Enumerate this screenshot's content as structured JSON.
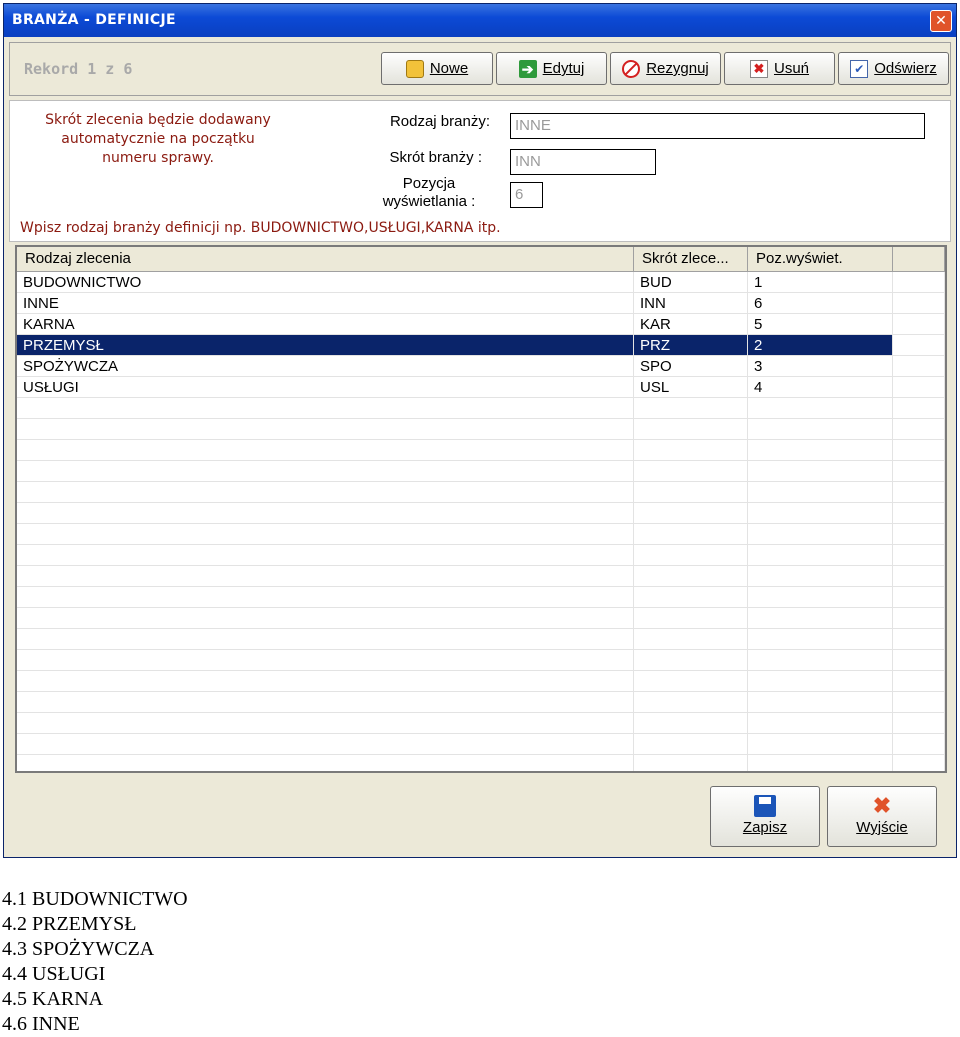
{
  "window": {
    "title": "BRANŻA - DEFINICJE"
  },
  "toolbar": {
    "record": "Rekord 1 z 6",
    "buttons": [
      {
        "label": "Nowe",
        "icon": "new-folder-icon"
      },
      {
        "label": "Edytuj",
        "icon": "edit-arrow-icon"
      },
      {
        "label": "Rezygnuj",
        "icon": "cancel-icon"
      },
      {
        "label": "Usuń",
        "icon": "delete-icon"
      },
      {
        "label": "Odświerz",
        "icon": "refresh-icon"
      }
    ]
  },
  "form": {
    "info_lines": [
      "Skrót zlecenia będzie dodawany",
      "automatycznie na początku",
      "numeru sprawy."
    ],
    "rodzaj_label": "Rodzaj branży:",
    "rodzaj_value": "INNE",
    "skrot_label": "Skrót branży :",
    "skrot_value": "INN",
    "pozycja_label_1": "Pozycja",
    "pozycja_label_2": "wyświetlania :",
    "pozycja_value": "6",
    "hint": "Wpisz rodzaj branży definicji np. BUDOWNICTWO,USŁUGI,KARNA itp."
  },
  "grid": {
    "columns": [
      "Rodzaj zlecenia",
      "Skrót zlece...",
      "Poz.wyświet."
    ],
    "rows": [
      [
        "BUDOWNICTWO",
        "BUD",
        "1"
      ],
      [
        "INNE",
        "INN",
        "6"
      ],
      [
        "KARNA",
        "KAR",
        "5"
      ],
      [
        "PRZEMYSŁ",
        "PRZ",
        "2"
      ],
      [
        "SPOŻYWCZA",
        "SPO",
        "3"
      ],
      [
        "USŁUGI",
        "USL",
        "4"
      ]
    ],
    "selected_row": 3
  },
  "footer": {
    "save_label": "Zapisz",
    "exit_label": "Wyjście"
  },
  "caption": [
    "4.1 BUDOWNICTWO",
    "4.2 PRZEMYSŁ",
    "4.3 SPOŻYWCZA",
    "4.4 USŁUGI",
    "4.5 KARNA",
    "4.6 INNE"
  ]
}
